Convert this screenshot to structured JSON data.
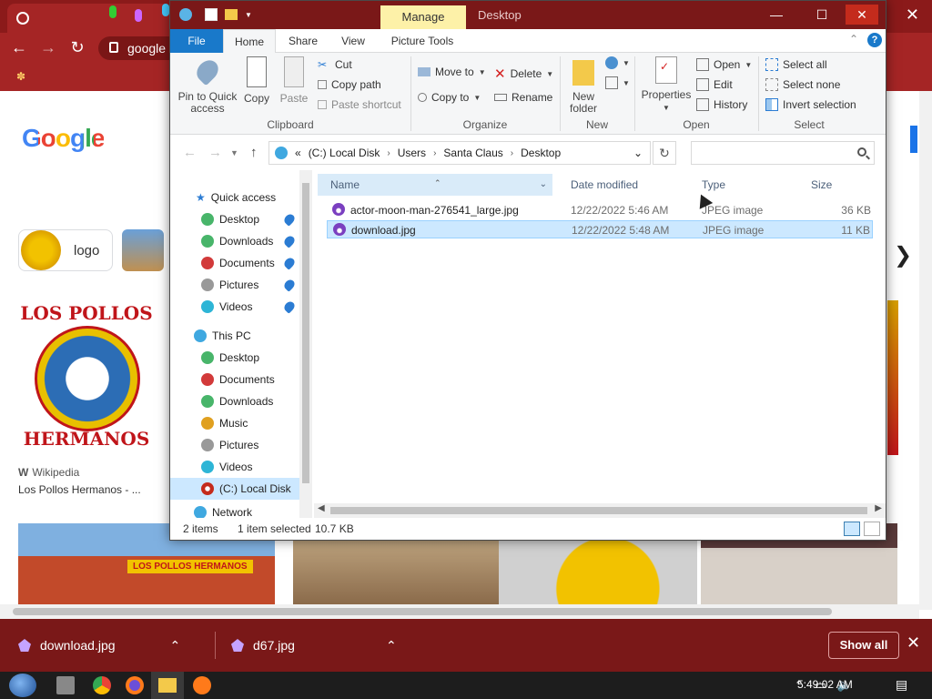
{
  "chrome": {
    "tab_title": "",
    "address": "google",
    "bookmark": ""
  },
  "google": {
    "logo": "Google",
    "chip_label": "logo",
    "result_source": "Wikipedia",
    "result_title": "Los Pollos Hermanos - ...",
    "seal_top": "LOS POLLOS",
    "seal_bottom": "HERMANOS",
    "strip_sign": "LOS POLLOS HERMANOS"
  },
  "downloads": {
    "items": [
      "download.jpg",
      "d67.jpg"
    ],
    "show_all": "Show all"
  },
  "taskbar": {
    "time": "5:49:02 AM"
  },
  "explorer": {
    "context_tab": "Manage",
    "title": "Desktop",
    "tabs": [
      "File",
      "Home",
      "Share",
      "View",
      "Picture Tools"
    ],
    "ribbon": {
      "clipboard": {
        "label": "Clipboard",
        "pin": "Pin to Quick access",
        "copy": "Copy",
        "paste": "Paste",
        "cut": "Cut",
        "copy_path": "Copy path",
        "paste_shortcut": "Paste shortcut"
      },
      "organize": {
        "label": "Organize",
        "move_to": "Move to",
        "copy_to": "Copy to",
        "delete": "Delete",
        "rename": "Rename"
      },
      "new": {
        "label": "New",
        "new_folder": "New folder"
      },
      "open": {
        "label": "Open",
        "properties": "Properties",
        "open": "Open",
        "edit": "Edit",
        "history": "History"
      },
      "select": {
        "label": "Select",
        "select_all": "Select all",
        "select_none": "Select none",
        "invert": "Invert selection"
      }
    },
    "breadcrumb": {
      "overflow": "«",
      "parts": [
        "(C:) Local Disk",
        "Users",
        "Santa Claus",
        "Desktop"
      ]
    },
    "search_placeholder": "",
    "nav": {
      "quick_access": "Quick access",
      "qa_items": [
        "Desktop",
        "Downloads",
        "Documents",
        "Pictures",
        "Videos"
      ],
      "this_pc": "This PC",
      "pc_items": [
        "Desktop",
        "Documents",
        "Downloads",
        "Music",
        "Pictures",
        "Videos",
        "(C:) Local Disk"
      ],
      "network": "Network"
    },
    "columns": [
      "Name",
      "Date modified",
      "Type",
      "Size"
    ],
    "files": [
      {
        "name": "actor-moon-man-276541_large.jpg",
        "date": "12/22/2022 5:46 AM",
        "type": "JPEG image",
        "size": "36 KB"
      },
      {
        "name": "download.jpg",
        "date": "12/22/2022 5:48 AM",
        "type": "JPEG image",
        "size": "11 KB"
      }
    ],
    "status": {
      "count": "2 items",
      "selected": "1 item selected",
      "size": "10.7 KB"
    }
  },
  "colors": {
    "chrome_frame": "#a52525",
    "title_bar": "#7a1818",
    "accent": "#1979ca",
    "selection": "#cce8ff",
    "manage_tab": "#fdf1a8"
  }
}
